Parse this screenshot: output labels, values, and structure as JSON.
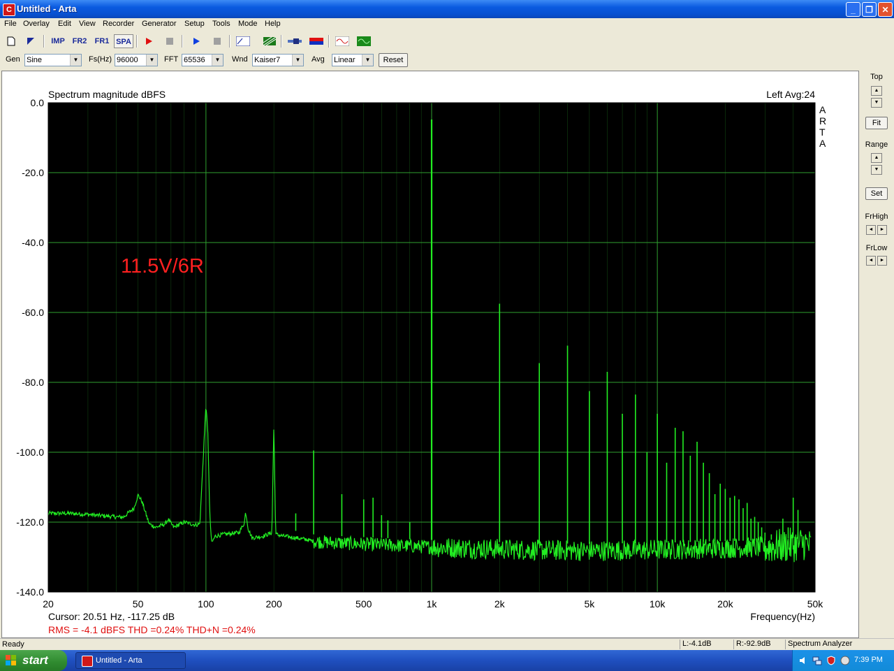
{
  "window": {
    "title": "Untitled - Arta",
    "app_icon": "arta-icon"
  },
  "window_controls": [
    "minimize-icon",
    "maximize-icon",
    "close-icon"
  ],
  "menu": [
    "File",
    "Overlay",
    "Edit",
    "View",
    "Recorder",
    "Generator",
    "Setup",
    "Tools",
    "Mode",
    "Help"
  ],
  "toolbar": {
    "imp": "IMP",
    "fr2": "FR2",
    "fr1": "FR1",
    "spa": "SPA",
    "icons": [
      "new-file-icon",
      "open-icon",
      "record-icon",
      "stop-icon",
      "play-icon",
      "stop-play-icon",
      "abc-icon",
      "grid-icon",
      "cable-icon",
      "color-bar-icon",
      "sine-icon",
      "wave-icon"
    ]
  },
  "controls": {
    "gen_label": "Gen",
    "gen_value": "Sine",
    "fs_label": "Fs(Hz)",
    "fs_value": "96000",
    "fft_label": "FFT",
    "fft_value": "65536",
    "wnd_label": "Wnd",
    "wnd_value": "Kaiser7",
    "avg_label": "Avg",
    "avg_value": "Linear",
    "reset_label": "Reset"
  },
  "side_panel": {
    "top_label": "Top",
    "fit_label": "Fit",
    "range_label": "Range",
    "set_label": "Set",
    "frhigh_label": "FrHigh",
    "frlow_label": "FrLow"
  },
  "chart_data": {
    "type": "line",
    "title": "Spectrum magnitude dBFS",
    "channel_info": "Left  Avg:24",
    "brand": "ARTA",
    "annotation": "11.5V/6R",
    "xlabel": "Frequency(Hz)",
    "ylabel": "",
    "x_scale": "log",
    "xlim": [
      20,
      50000
    ],
    "ylim": [
      -140,
      0
    ],
    "x_ticks": [
      20,
      50,
      100,
      200,
      500,
      1000,
      2000,
      5000,
      10000,
      20000,
      50000
    ],
    "x_tick_labels": [
      "20",
      "50",
      "100",
      "200",
      "500",
      "1k",
      "2k",
      "5k",
      "10k",
      "20k",
      "50k"
    ],
    "y_ticks": [
      0,
      -20,
      -40,
      -60,
      -80,
      -100,
      -120,
      -140
    ],
    "y_tick_labels": [
      "0.0",
      "-20.0",
      "-40.0",
      "-60.0",
      "-80.0",
      "-100.0",
      "-120.0",
      "-140.0"
    ],
    "grid": true,
    "background": "#000000",
    "line_color": "#22ee22",
    "grid_color": "#1d7a1d",
    "annotation_color": "#ff2020",
    "cursor_text": "Cursor: 20.51 Hz, -117.25 dB",
    "measurement_text": "RMS =   -4.1 dBFS   THD =0.24%   THD+N =0.24%",
    "noise_floor": [
      [
        20,
        -117.5
      ],
      [
        25,
        -117.5
      ],
      [
        30,
        -117.8
      ],
      [
        35,
        -118.2
      ],
      [
        40,
        -118.5
      ],
      [
        43,
        -118.6
      ],
      [
        48,
        -116
      ],
      [
        50,
        -112.2
      ],
      [
        52,
        -114
      ],
      [
        56,
        -120.5
      ],
      [
        60,
        -121.5
      ],
      [
        66,
        -120.5
      ],
      [
        68,
        -119.2
      ],
      [
        72,
        -121.5
      ],
      [
        80,
        -120
      ],
      [
        90,
        -120.8
      ],
      [
        94,
        -120.5
      ],
      [
        100,
        -86.2
      ],
      [
        102,
        -95
      ],
      [
        104,
        -118
      ],
      [
        106,
        -126
      ],
      [
        110,
        -124
      ],
      [
        120,
        -123.5
      ],
      [
        140,
        -123
      ],
      [
        148,
        -120.2
      ],
      [
        150,
        -117
      ],
      [
        154,
        -122
      ],
      [
        160,
        -124.5
      ],
      [
        180,
        -124
      ],
      [
        196,
        -123
      ],
      [
        200,
        -92
      ],
      [
        202,
        -110
      ],
      [
        204,
        -123.5
      ],
      [
        220,
        -124
      ],
      [
        250,
        -124.5
      ],
      [
        280,
        -125
      ],
      [
        300,
        -125.5
      ],
      [
        400,
        -126
      ],
      [
        600,
        -126.5
      ],
      [
        900,
        -127
      ],
      [
        1200,
        -127.3
      ],
      [
        2000,
        -127.7
      ],
      [
        3000,
        -128
      ],
      [
        5000,
        -128.2
      ],
      [
        8000,
        -128
      ],
      [
        12000,
        -127.8
      ],
      [
        20000,
        -127.4
      ],
      [
        30000,
        -127.2
      ],
      [
        40000,
        -126.5
      ],
      [
        45000,
        -126
      ],
      [
        48000,
        -127
      ]
    ],
    "harmonics": [
      [
        250,
        -117.5
      ],
      [
        300,
        -99.5
      ],
      [
        400,
        -112
      ],
      [
        500,
        -113.5
      ],
      [
        550,
        -113
      ],
      [
        600,
        -118
      ],
      [
        640,
        -119.5
      ],
      [
        800,
        -120
      ],
      [
        1000,
        -4.8
      ],
      [
        2000,
        -57.5
      ],
      [
        3000,
        -74.5
      ],
      [
        4000,
        -69.5
      ],
      [
        5000,
        -82.5
      ],
      [
        6000,
        -77
      ],
      [
        7000,
        -89
      ],
      [
        8000,
        -83.5
      ],
      [
        9000,
        -100
      ],
      [
        10000,
        -89
      ],
      [
        11000,
        -103
      ],
      [
        12000,
        -93
      ],
      [
        13000,
        -94
      ],
      [
        14000,
        -101
      ],
      [
        15000,
        -97
      ],
      [
        16000,
        -103
      ],
      [
        17000,
        -106
      ],
      [
        18000,
        -112
      ],
      [
        19000,
        -109
      ],
      [
        20000,
        -110.5
      ],
      [
        21000,
        -113
      ],
      [
        22000,
        -112.5
      ],
      [
        23000,
        -113.5
      ],
      [
        24000,
        -116
      ],
      [
        25000,
        -114.5
      ],
      [
        26000,
        -119
      ],
      [
        27000,
        -118.5
      ],
      [
        28000,
        -120
      ],
      [
        29000,
        -121.5
      ],
      [
        30000,
        -123
      ],
      [
        32000,
        -123.5
      ],
      [
        36000,
        -119
      ],
      [
        38000,
        -121.5
      ],
      [
        40000,
        -113
      ],
      [
        42000,
        -116.5
      ]
    ]
  },
  "status": {
    "ready": "Ready",
    "left_level": "L:-4.1dB",
    "right_level": "R:-92.9dB",
    "mode": "Spectrum Analyzer"
  },
  "taskbar": {
    "start_label": "start",
    "task_label": "Untitled - Arta",
    "clock": "7:39 PM",
    "tray_icons": [
      "speaker-icon",
      "network-icon",
      "shield-icon",
      "display-icon"
    ]
  }
}
